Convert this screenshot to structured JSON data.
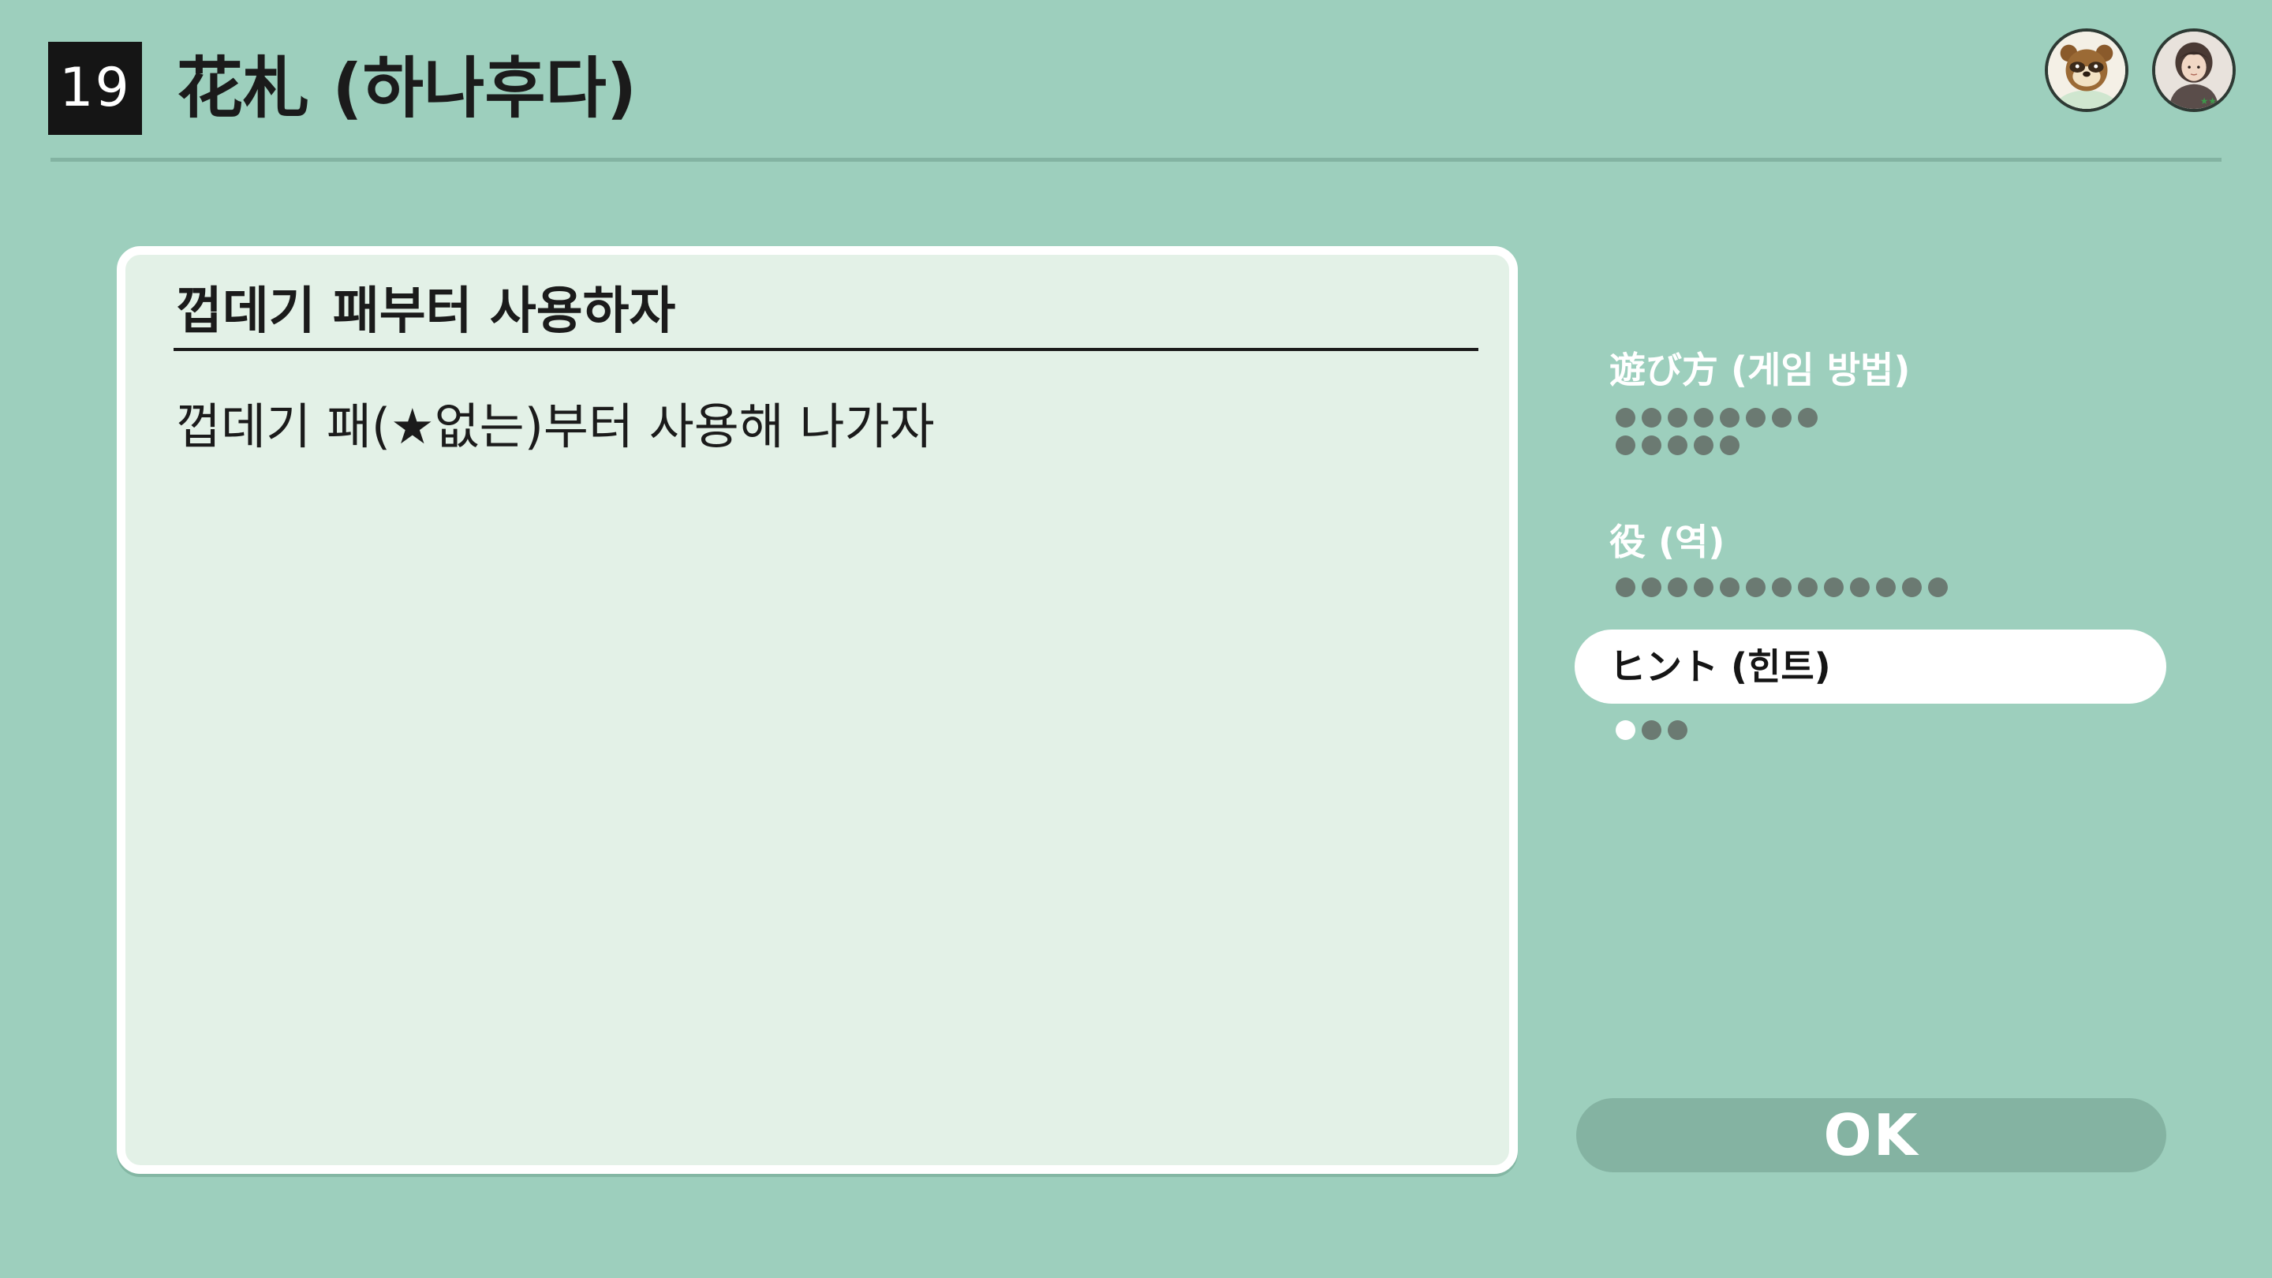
{
  "header": {
    "game_number": "19",
    "game_title": "花札 (하나후다)"
  },
  "avatars": [
    {
      "icon": "raccoon-character-icon"
    },
    {
      "icon": "player-character-icon"
    }
  ],
  "content": {
    "heading": "껍데기 패부터 사용하자",
    "body": "껍데기 패(★없는)부터 사용해 나가자"
  },
  "side_menu": {
    "items": [
      {
        "label": "遊び方 (게임 방법)",
        "page_count": 13,
        "current_page": null,
        "active": false
      },
      {
        "label": "役 (역)",
        "page_count": 13,
        "current_page": null,
        "active": false
      },
      {
        "label": "ヒント (힌트)",
        "page_count": 3,
        "current_page": 1,
        "active": true
      }
    ]
  },
  "buttons": {
    "ok_label": "OK"
  },
  "colors": {
    "background": "#9dcfbd",
    "panel": "#e3f1e7",
    "active_item": "#ffffff",
    "ok_button": "#84b3a2",
    "dot": "#6b7a72"
  }
}
